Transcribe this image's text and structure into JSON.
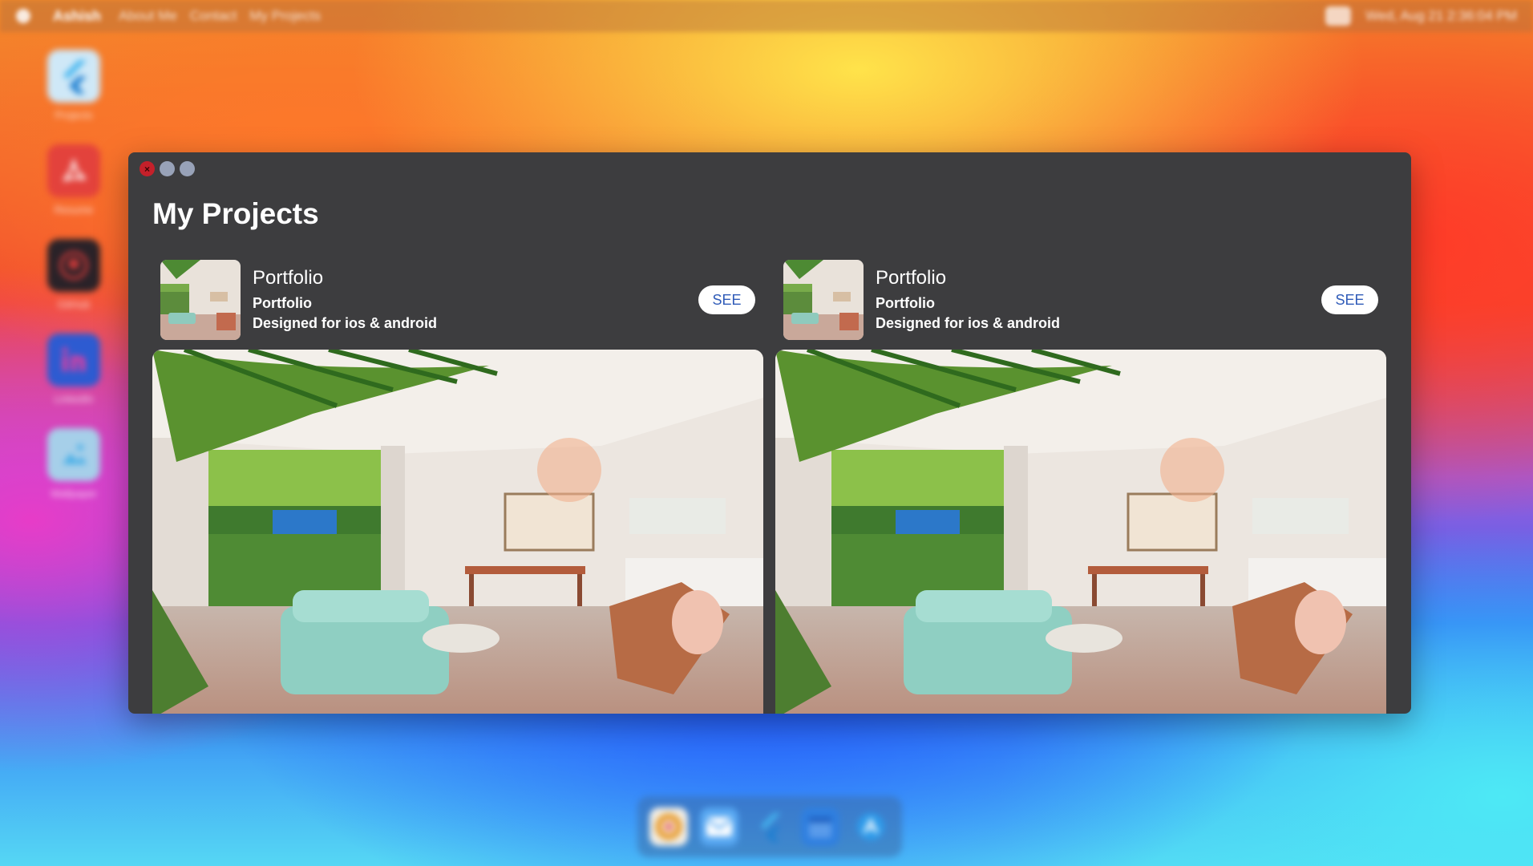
{
  "menubar": {
    "app_name": "Ashish",
    "items": [
      "About Me",
      "Contact",
      "My Projects"
    ],
    "clock": "Wed, Aug 21 2:36:04 PM"
  },
  "desktop_icons": [
    {
      "label": "Projects",
      "icon": "flutter-icon",
      "color": "#6cc6f5"
    },
    {
      "label": "Resume",
      "icon": "pdf-icon",
      "color": "#e3423c"
    },
    {
      "label": "GitHub",
      "icon": "github-icon",
      "color": "#222222"
    },
    {
      "label": "LinkedIn",
      "icon": "linkedin-icon",
      "color": "#2d5bd1"
    },
    {
      "label": "Wallpaper",
      "icon": "image-icon",
      "color": "#9fc6e6"
    }
  ],
  "dock_items": [
    {
      "icon": "chrome-icon",
      "color": "#f2b84b"
    },
    {
      "icon": "mail-icon",
      "color": "#4fa4f2"
    },
    {
      "icon": "flutter-icon",
      "color": "#3fa0e6"
    },
    {
      "icon": "calendar-icon",
      "color": "#2f7fe0"
    },
    {
      "icon": "app-store-icon",
      "color": "#2e9bea"
    }
  ],
  "window": {
    "close_glyph": "×",
    "title": "My Projects"
  },
  "projects": [
    {
      "name": "Portfolio",
      "subtitle": "Portfolio",
      "description": "Designed for ios & android",
      "button_label": "SEE"
    },
    {
      "name": "Portfolio",
      "subtitle": "Portfolio",
      "description": "Designed for ios & android",
      "button_label": "SEE"
    }
  ],
  "colors": {
    "window_bg": "#3d3d3f",
    "close_button": "#c4202a",
    "button_text": "#2f5bb8"
  }
}
